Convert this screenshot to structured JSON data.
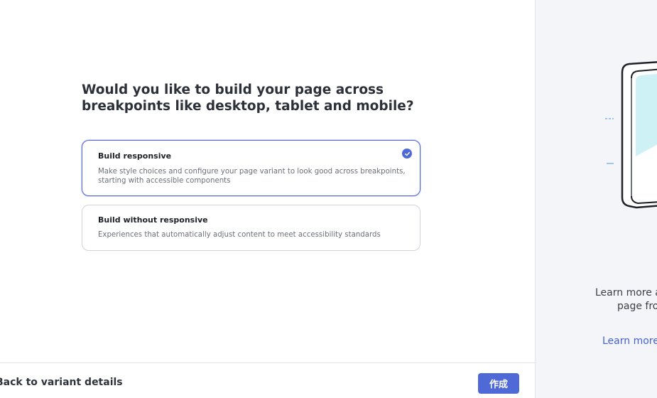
{
  "question": {
    "line1": "Would you like to build your page across",
    "line2": "breakpoints like desktop, tablet and mobile?"
  },
  "options": [
    {
      "title": "Build responsive",
      "description": "Make style choices and configure your page variant to look good across breakpoints, starting with accessible components",
      "selected": true
    },
    {
      "title": "Build without responsive",
      "description": "Experiences that automatically adjust content to meet accessibility standards",
      "selected": false
    }
  ],
  "footer": {
    "back_label": "Back to variant details",
    "create_label": "作成"
  },
  "side_panel": {
    "text_line1": "Learn more a",
    "text_line2": "page fro",
    "link_label": "Learn more"
  },
  "colors": {
    "accent": "#4f69d6",
    "link": "#4462d4",
    "panel_bg": "#f4f5f8",
    "illustration_fill": "#cdf1f4"
  }
}
